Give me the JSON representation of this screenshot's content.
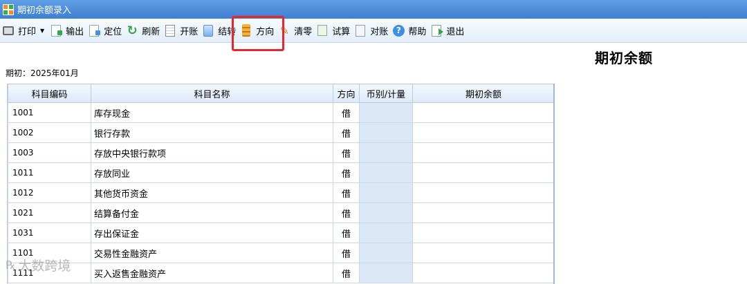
{
  "window": {
    "title": "期初余额录入"
  },
  "toolbar": {
    "buttons": [
      {
        "label": "打印",
        "icon": "printer-icon"
      },
      {
        "label": "输出",
        "icon": "export-icon"
      },
      {
        "label": "定位",
        "icon": "locate-icon"
      },
      {
        "label": "刷新",
        "icon": "refresh-icon"
      },
      {
        "label": "开账",
        "icon": "open-book-icon"
      },
      {
        "label": "结转",
        "icon": "carry-over-icon"
      },
      {
        "label": "方向",
        "icon": "direction-icon"
      },
      {
        "label": "清零",
        "icon": "broom-icon"
      },
      {
        "label": "试算",
        "icon": "calculator-icon"
      },
      {
        "label": "对账",
        "icon": "reconcile-icon"
      },
      {
        "label": "帮助",
        "icon": "help-icon"
      },
      {
        "label": "退出",
        "icon": "exit-icon"
      }
    ]
  },
  "report": {
    "title": "期初余额",
    "period": "期初：2025年01月"
  },
  "table": {
    "columns": [
      "科目编码",
      "科目名称",
      "方向",
      "币别/计量",
      "期初余额"
    ],
    "rows": [
      {
        "code": "1001",
        "name": "库存现金",
        "dir": "借"
      },
      {
        "code": "1002",
        "name": "银行存款",
        "dir": "借"
      },
      {
        "code": "1003",
        "name": "存放中央银行款项",
        "dir": "借"
      },
      {
        "code": "1011",
        "name": "存放同业",
        "dir": "借"
      },
      {
        "code": "1012",
        "name": "其他货币资金",
        "dir": "借"
      },
      {
        "code": "1021",
        "name": "结算备付金",
        "dir": "借"
      },
      {
        "code": "1031",
        "name": "存出保证金",
        "dir": "借"
      },
      {
        "code": "1101",
        "name": "交易性金融资产",
        "dir": "借"
      },
      {
        "code": "1111",
        "name": "买入返售金融资产",
        "dir": "借"
      }
    ]
  },
  "watermark": {
    "text": "大数跨境"
  },
  "colors": {
    "titlebar": "#4a8ad9",
    "highlight": "#e8262c",
    "currency_cell": "#dbe8f7"
  }
}
